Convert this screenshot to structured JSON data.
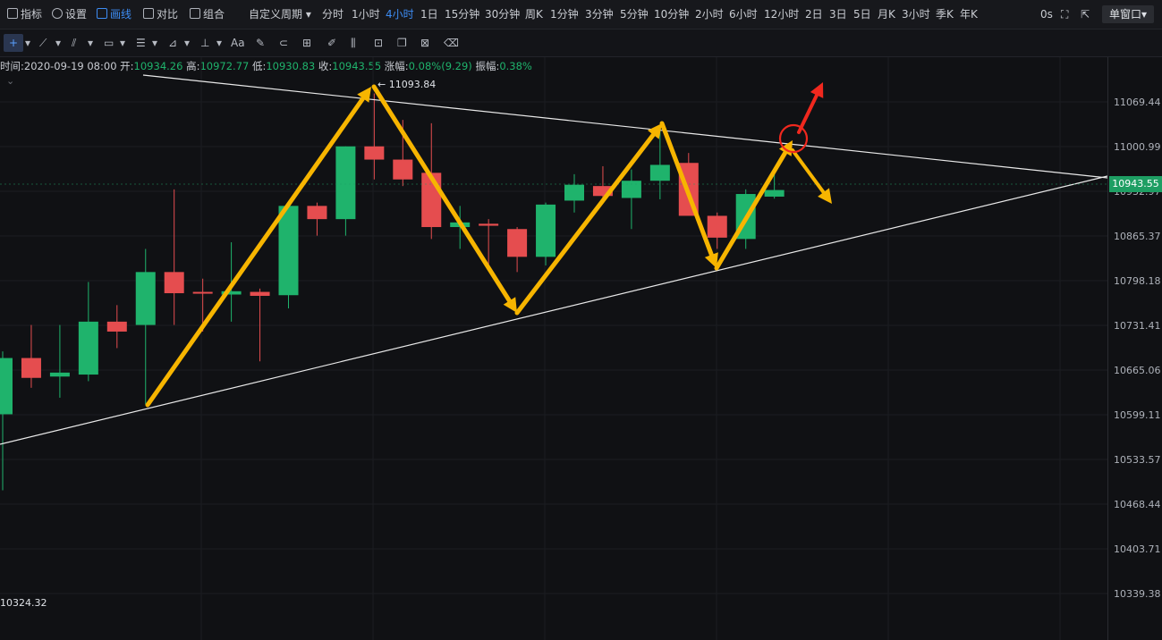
{
  "topbar": {
    "indicators": "指标",
    "settings": "设置",
    "draw": "画线",
    "compare": "对比",
    "combine": "组合",
    "custom_period": "自定义周期",
    "periods": [
      "分时",
      "1小时",
      "4小时",
      "1日",
      "15分钟",
      "30分钟",
      "周K",
      "1分钟",
      "3分钟",
      "5分钟",
      "10分钟",
      "2小时",
      "6小时",
      "12小时",
      "2日",
      "3日",
      "5日",
      "月K",
      "3小时",
      "季K",
      "年K"
    ],
    "active_period": "4小时",
    "countdown": "0s",
    "window_mode": "单窗口"
  },
  "toolbar": {
    "text_tool": "Aa"
  },
  "info": {
    "time_label": "时间:",
    "time": "2020-09-19 08:00",
    "open_label": "开:",
    "open": "10934.26",
    "high_label": "高:",
    "high": "10972.77",
    "low_label": "低:",
    "low": "10930.83",
    "close_label": "收:",
    "close": "10943.55",
    "change_label": "涨幅:",
    "change": "0.08%(9.29)",
    "amplitude_label": "振幅:",
    "amplitude": "0.38%"
  },
  "chart_data": {
    "type": "candlestick",
    "ticks": [
      "11069.44",
      "11000.99",
      "10932.97",
      "10865.37",
      "10798.18",
      "10731.41",
      "10665.06",
      "10599.11",
      "10533.57",
      "10468.44",
      "10403.71",
      "10339.38"
    ],
    "current_price": "10943.55",
    "high_marker": "11093.84",
    "low_marker": "10324.32",
    "colors": {
      "up": "#1fb36c",
      "down": "#e54d4f",
      "arrow": "#f7b500",
      "breakout": "#f0281e"
    },
    "candles": [
      {
        "o": 10605,
        "h": 10700,
        "l": 10490,
        "c": 10690
      },
      {
        "o": 10690,
        "h": 10740,
        "l": 10645,
        "c": 10660
      },
      {
        "o": 10662,
        "h": 10740,
        "l": 10630,
        "c": 10668
      },
      {
        "o": 10665,
        "h": 10805,
        "l": 10655,
        "c": 10745
      },
      {
        "o": 10745,
        "h": 10770,
        "l": 10705,
        "c": 10730
      },
      {
        "o": 10740,
        "h": 10855,
        "l": 10620,
        "c": 10820
      },
      {
        "o": 10820,
        "h": 10945,
        "l": 10740,
        "c": 10788
      },
      {
        "o": 10790,
        "h": 10810,
        "l": 10730,
        "c": 10788
      },
      {
        "o": 10786,
        "h": 10865,
        "l": 10745,
        "c": 10791
      },
      {
        "o": 10790,
        "h": 10795,
        "l": 10685,
        "c": 10784
      },
      {
        "o": 10785,
        "h": 10920,
        "l": 10765,
        "c": 10920
      },
      {
        "o": 10920,
        "h": 10925,
        "l": 10875,
        "c": 10900
      },
      {
        "o": 10900,
        "h": 11010,
        "l": 10875,
        "c": 11010
      },
      {
        "o": 11010,
        "h": 11090,
        "l": 10960,
        "c": 10990
      },
      {
        "o": 10990,
        "h": 11050,
        "l": 10950,
        "c": 10960
      },
      {
        "o": 10970,
        "h": 11045,
        "l": 10870,
        "c": 10888
      },
      {
        "o": 10888,
        "h": 10920,
        "l": 10855,
        "c": 10895
      },
      {
        "o": 10893,
        "h": 10900,
        "l": 10825,
        "c": 10890
      },
      {
        "o": 10885,
        "h": 10888,
        "l": 10820,
        "c": 10843
      },
      {
        "o": 10843,
        "h": 10925,
        "l": 10830,
        "c": 10922
      },
      {
        "o": 10928,
        "h": 10968,
        "l": 10910,
        "c": 10952
      },
      {
        "o": 10950,
        "h": 10980,
        "l": 10925,
        "c": 10935
      },
      {
        "o": 10932,
        "h": 10975,
        "l": 10885,
        "c": 10958
      },
      {
        "o": 10958,
        "h": 11040,
        "l": 10930,
        "c": 10982
      },
      {
        "o": 10985,
        "h": 11000,
        "l": 10910,
        "c": 10905
      },
      {
        "o": 10905,
        "h": 10910,
        "l": 10855,
        "c": 10872
      },
      {
        "o": 10870,
        "h": 10945,
        "l": 10855,
        "c": 10938
      },
      {
        "o": 10934,
        "h": 10973,
        "l": 10931,
        "c": 10944
      }
    ]
  }
}
